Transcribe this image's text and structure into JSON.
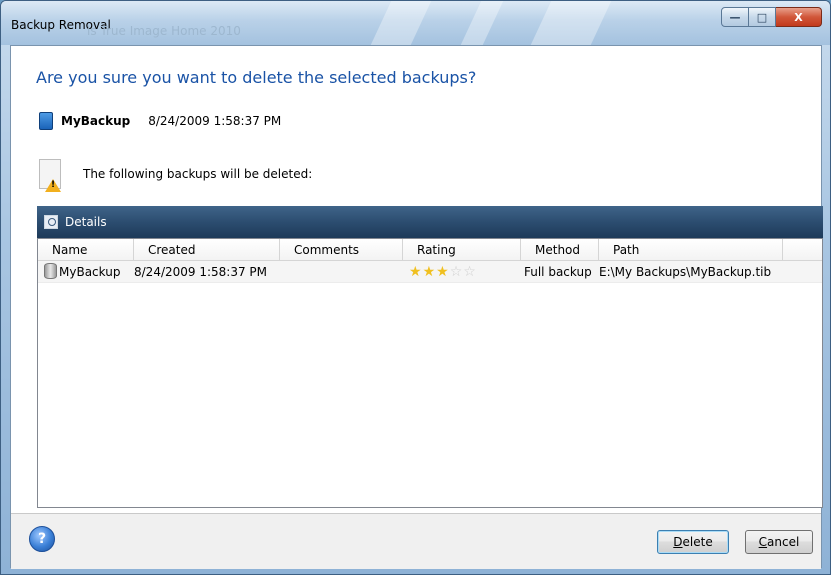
{
  "window": {
    "title": "Backup Removal",
    "title_ghost": "is True Image Home 2010",
    "controls": {
      "minimize": "—",
      "maximize": "□",
      "close": "X"
    }
  },
  "dialog": {
    "question": "Are you sure you want to delete the selected backups?",
    "backup_name": "MyBackup",
    "backup_date": "8/24/2009 1:58:37 PM",
    "warning_text": "The following backups will be deleted:"
  },
  "details": {
    "label": "Details",
    "columns": [
      "Name",
      "Created",
      "Comments",
      "Rating",
      "Method",
      "Path"
    ],
    "rows": [
      {
        "name": "MyBackup",
        "created": "8/24/2009 1:58:37 PM",
        "comments": "",
        "rating": 3,
        "rating_max": 5,
        "method": "Full backup",
        "path": "E:\\My Backups\\MyBackup.tib"
      }
    ]
  },
  "footer": {
    "help_glyph": "?",
    "delete_label_u": "D",
    "delete_label_rest": "elete",
    "cancel_label_u": "C",
    "cancel_label_rest": "ancel"
  },
  "colors": {
    "question": "#1a53a6",
    "details_bar": "#2c4d70",
    "star_on": "#f0c020",
    "star_off": "#cfcfcf"
  },
  "icons": [
    "disk-icon",
    "warning-document-icon",
    "magnifier-icon",
    "database-icon",
    "star-icon",
    "help-icon"
  ]
}
